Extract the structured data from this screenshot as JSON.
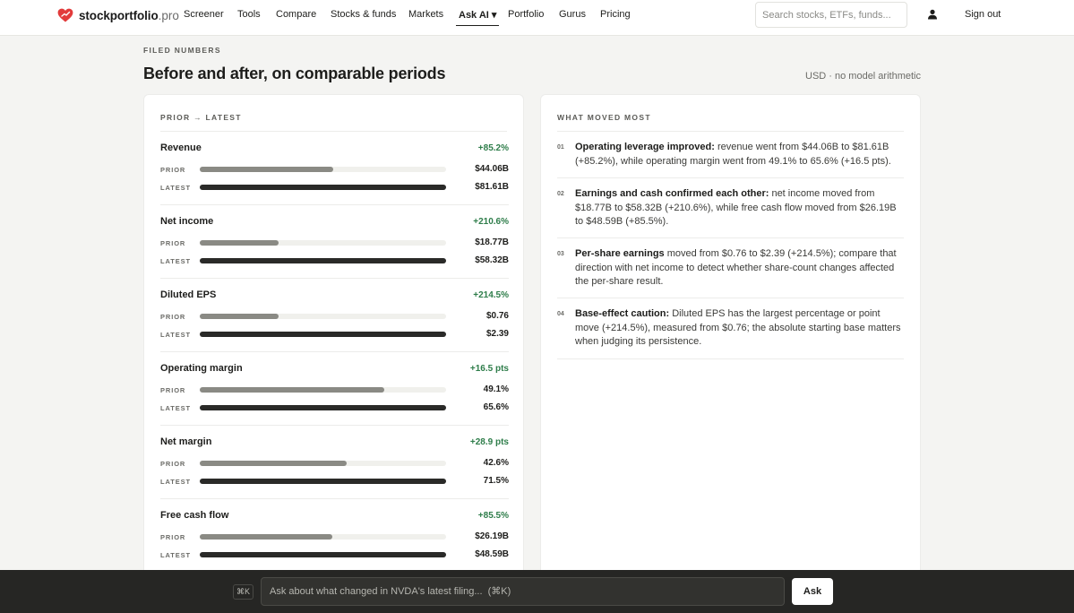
{
  "brand": {
    "name": "stockportfolio",
    "tld": ".pro",
    "accent": "#e23b3b"
  },
  "nav": {
    "items": [
      {
        "label": "Screener"
      },
      {
        "label": "Tools"
      },
      {
        "label": "Compare"
      },
      {
        "label": "Stocks & funds"
      },
      {
        "label": "Markets"
      },
      {
        "label": "Ask AI ▾",
        "active": true
      },
      {
        "label": "Portfolio"
      },
      {
        "label": "Gurus"
      },
      {
        "label": "Pricing"
      }
    ],
    "search_placeholder": "Search stocks, ETFs, funds...",
    "user_icon": "user-icon",
    "sign_out": "Sign out"
  },
  "header": {
    "eyebrow": "FILED NUMBERS",
    "title": "Before and after, on comparable periods",
    "note": "USD · no model arithmetic"
  },
  "comparison": {
    "eyebrow": "PRIOR → LATEST",
    "prior_label": "PRIOR",
    "latest_label": "LATEST",
    "positive_color": "#2e7d4a",
    "metrics": [
      {
        "name": "Revenue",
        "change": "+85.2%",
        "prior": "$44.06B",
        "latest": "$81.61B",
        "prior_level": 0.54,
        "latest_level": 1.0
      },
      {
        "name": "Net income",
        "change": "+210.6%",
        "prior": "$18.77B",
        "latest": "$58.32B",
        "prior_level": 0.32,
        "latest_level": 1.0
      },
      {
        "name": "Diluted EPS",
        "change": "+214.5%",
        "prior": "$0.76",
        "latest": "$2.39",
        "prior_level": 0.32,
        "latest_level": 1.0
      },
      {
        "name": "Operating margin",
        "change": "+16.5 pts",
        "prior": "49.1%",
        "latest": "65.6%",
        "prior_level": 0.748,
        "latest_level": 1.0
      },
      {
        "name": "Net margin",
        "change": "+28.9 pts",
        "prior": "42.6%",
        "latest": "71.5%",
        "prior_level": 0.596,
        "latest_level": 1.0
      },
      {
        "name": "Free cash flow",
        "change": "+85.5%",
        "prior": "$26.19B",
        "latest": "$48.59B",
        "prior_level": 0.539,
        "latest_level": 1.0
      }
    ]
  },
  "insights": {
    "eyebrow": "WHAT MOVED MOST",
    "items": [
      {
        "num": "01",
        "lead": "Operating leverage improved:",
        "text": " revenue went from $44.06B to $81.61B (+85.2%), while operating margin went from 49.1% to 65.6% (+16.5 pts)."
      },
      {
        "num": "02",
        "lead": "Earnings and cash confirmed each other:",
        "text": " net income moved from $18.77B to $58.32B (+210.6%), while free cash flow moved from $26.19B to $48.59B (+85.5%)."
      },
      {
        "num": "03",
        "lead": "Per-share earnings",
        "text": " moved from $0.76 to $2.39 (+214.5%); compare that direction with net income to detect whether share-count changes affected the per-share result."
      },
      {
        "num": "04",
        "lead": "Base-effect caution:",
        "text": " Diluted EPS has the largest percentage or point move (+214.5%), measured from $0.76; the absolute starting base matters when judging its persistence."
      }
    ]
  },
  "ask": {
    "shortcut": "⌘K",
    "placeholder": "Ask about what changed in NVDA's latest filing...  (⌘K)",
    "button": "Ask"
  }
}
